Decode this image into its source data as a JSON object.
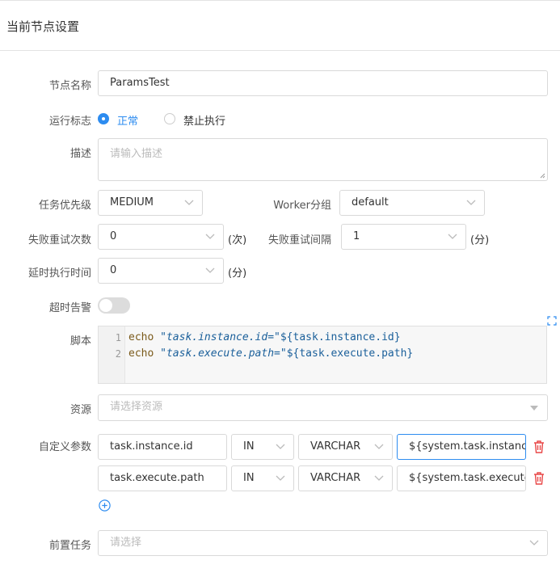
{
  "header": {
    "title": "当前节点设置"
  },
  "form": {
    "node_name": {
      "label": "节点名称",
      "value": "ParamsTest"
    },
    "run_flag": {
      "label": "运行标志",
      "options": [
        "正常",
        "禁止执行"
      ],
      "selected": "正常"
    },
    "description": {
      "label": "描述",
      "placeholder": "请输入描述"
    },
    "priority": {
      "label": "任务优先级",
      "value": "MEDIUM"
    },
    "worker_group": {
      "label": "Worker分组",
      "value": "default"
    },
    "fail_retry_times": {
      "label": "失败重试次数",
      "value": "0",
      "unit": "(次)"
    },
    "fail_retry_interval": {
      "label": "失败重试间隔",
      "value": "1",
      "unit": "(分)"
    },
    "delay_time": {
      "label": "延时执行时间",
      "value": "0",
      "unit": "(分)"
    },
    "timeout_alarm": {
      "label": "超时告警",
      "enabled": false
    },
    "script": {
      "label": "脚本",
      "lines": [
        {
          "no": "1",
          "kw": "echo",
          "str": "\"task.instance.id=\"",
          "var": "${task.instance.id}"
        },
        {
          "no": "2",
          "kw": "echo",
          "str": "\"task.execute.path=\"",
          "var": "${task.execute.path}"
        }
      ]
    },
    "resources": {
      "label": "资源",
      "placeholder": "请选择资源"
    },
    "custom_params": {
      "label": "自定义参数",
      "rows": [
        {
          "prop": "task.instance.id",
          "direct": "IN",
          "type": "VARCHAR",
          "value": "${system.task.instance.id}"
        },
        {
          "prop": "task.execute.path",
          "direct": "IN",
          "type": "VARCHAR",
          "value": "${system.task.execute.path}"
        }
      ]
    },
    "pre_tasks": {
      "label": "前置任务",
      "placeholder": "请选择"
    }
  },
  "colors": {
    "accent": "#2d8cf0",
    "danger": "#e84747",
    "border": "#d9d9d9"
  },
  "icons": [
    "chevron-down-icon",
    "fullscreen-icon",
    "trash-icon",
    "add-circle-icon"
  ]
}
